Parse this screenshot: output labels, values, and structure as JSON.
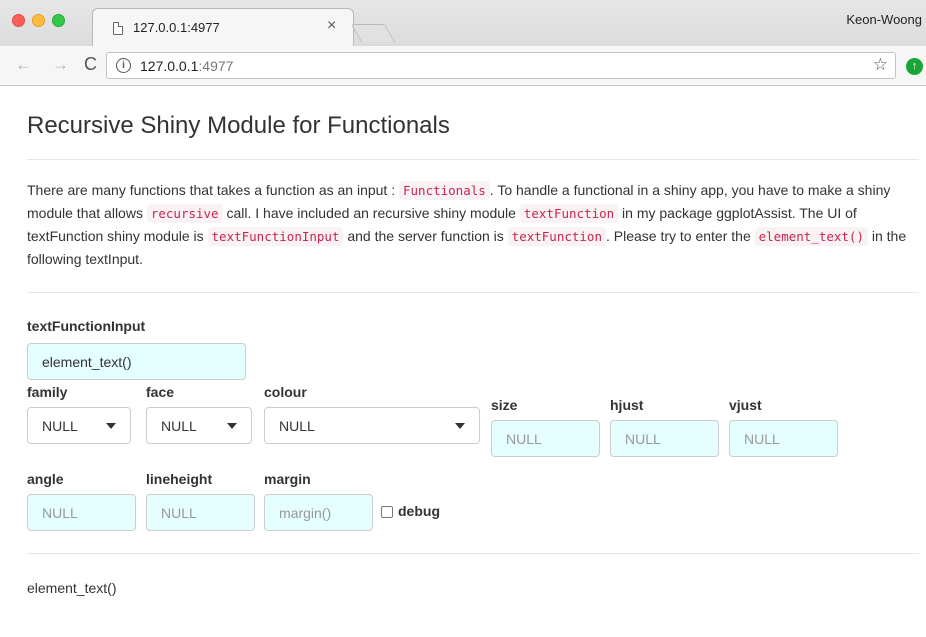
{
  "browser": {
    "tab_title": "127.0.0.1:4977",
    "tab_close": "×",
    "profile_name": "Keon-Woong",
    "url_host": "127.0.0.1",
    "url_port": ":4977",
    "info_glyph": "i",
    "back_glyph": "←",
    "forward_glyph": "→",
    "reload_glyph": "C",
    "star_glyph": "☆",
    "extension_glyph": "↑",
    "extension_color": "#1aa539"
  },
  "page": {
    "title": "Recursive Shiny Module for Functionals",
    "desc": [
      "There are many functions that takes a function as an input : ",
      "Functionals",
      ". To handle a functional in a shiny app, you have to make a shiny module that allows ",
      "recursive",
      " call. I have included an recursive shiny module ",
      "textFunction",
      " in my package ggplotAssist. The UI of textFunction shiny module is ",
      "textFunctionInput",
      " and the server function is ",
      "textFunction",
      ". Please try to enter the ",
      "element_text()",
      " in the following textInput."
    ],
    "code_color": "#c7254e"
  },
  "form": {
    "main_label": "textFunctionInput",
    "main_value": "element_text()",
    "input_bg": "#e5feff",
    "family": {
      "label": "family",
      "value": "NULL"
    },
    "face": {
      "label": "face",
      "value": "NULL"
    },
    "colour": {
      "label": "colour",
      "value": "NULL"
    },
    "size": {
      "label": "size",
      "placeholder": "NULL"
    },
    "hjust": {
      "label": "hjust",
      "placeholder": "NULL"
    },
    "vjust": {
      "label": "vjust",
      "placeholder": "NULL"
    },
    "angle": {
      "label": "angle",
      "placeholder": "NULL"
    },
    "lineheight": {
      "label": "lineheight",
      "placeholder": "NULL"
    },
    "margin": {
      "label": "margin",
      "placeholder": "margin()"
    },
    "debug": {
      "label": "debug",
      "checked": false
    }
  },
  "output": {
    "text": "element_text()"
  }
}
